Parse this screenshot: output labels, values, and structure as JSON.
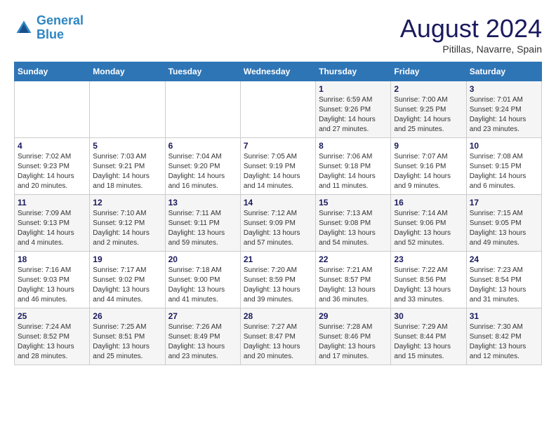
{
  "header": {
    "logo_line1": "General",
    "logo_line2": "Blue",
    "title": "August 2024",
    "subtitle": "Pitillas, Navarre, Spain"
  },
  "days_of_week": [
    "Sunday",
    "Monday",
    "Tuesday",
    "Wednesday",
    "Thursday",
    "Friday",
    "Saturday"
  ],
  "weeks": [
    [
      {
        "day": "",
        "info": ""
      },
      {
        "day": "",
        "info": ""
      },
      {
        "day": "",
        "info": ""
      },
      {
        "day": "",
        "info": ""
      },
      {
        "day": "1",
        "info": "Sunrise: 6:59 AM\nSunset: 9:26 PM\nDaylight: 14 hours and 27 minutes."
      },
      {
        "day": "2",
        "info": "Sunrise: 7:00 AM\nSunset: 9:25 PM\nDaylight: 14 hours and 25 minutes."
      },
      {
        "day": "3",
        "info": "Sunrise: 7:01 AM\nSunset: 9:24 PM\nDaylight: 14 hours and 23 minutes."
      }
    ],
    [
      {
        "day": "4",
        "info": "Sunrise: 7:02 AM\nSunset: 9:23 PM\nDaylight: 14 hours and 20 minutes."
      },
      {
        "day": "5",
        "info": "Sunrise: 7:03 AM\nSunset: 9:21 PM\nDaylight: 14 hours and 18 minutes."
      },
      {
        "day": "6",
        "info": "Sunrise: 7:04 AM\nSunset: 9:20 PM\nDaylight: 14 hours and 16 minutes."
      },
      {
        "day": "7",
        "info": "Sunrise: 7:05 AM\nSunset: 9:19 PM\nDaylight: 14 hours and 14 minutes."
      },
      {
        "day": "8",
        "info": "Sunrise: 7:06 AM\nSunset: 9:18 PM\nDaylight: 14 hours and 11 minutes."
      },
      {
        "day": "9",
        "info": "Sunrise: 7:07 AM\nSunset: 9:16 PM\nDaylight: 14 hours and 9 minutes."
      },
      {
        "day": "10",
        "info": "Sunrise: 7:08 AM\nSunset: 9:15 PM\nDaylight: 14 hours and 6 minutes."
      }
    ],
    [
      {
        "day": "11",
        "info": "Sunrise: 7:09 AM\nSunset: 9:13 PM\nDaylight: 14 hours and 4 minutes."
      },
      {
        "day": "12",
        "info": "Sunrise: 7:10 AM\nSunset: 9:12 PM\nDaylight: 14 hours and 2 minutes."
      },
      {
        "day": "13",
        "info": "Sunrise: 7:11 AM\nSunset: 9:11 PM\nDaylight: 13 hours and 59 minutes."
      },
      {
        "day": "14",
        "info": "Sunrise: 7:12 AM\nSunset: 9:09 PM\nDaylight: 13 hours and 57 minutes."
      },
      {
        "day": "15",
        "info": "Sunrise: 7:13 AM\nSunset: 9:08 PM\nDaylight: 13 hours and 54 minutes."
      },
      {
        "day": "16",
        "info": "Sunrise: 7:14 AM\nSunset: 9:06 PM\nDaylight: 13 hours and 52 minutes."
      },
      {
        "day": "17",
        "info": "Sunrise: 7:15 AM\nSunset: 9:05 PM\nDaylight: 13 hours and 49 minutes."
      }
    ],
    [
      {
        "day": "18",
        "info": "Sunrise: 7:16 AM\nSunset: 9:03 PM\nDaylight: 13 hours and 46 minutes."
      },
      {
        "day": "19",
        "info": "Sunrise: 7:17 AM\nSunset: 9:02 PM\nDaylight: 13 hours and 44 minutes."
      },
      {
        "day": "20",
        "info": "Sunrise: 7:18 AM\nSunset: 9:00 PM\nDaylight: 13 hours and 41 minutes."
      },
      {
        "day": "21",
        "info": "Sunrise: 7:20 AM\nSunset: 8:59 PM\nDaylight: 13 hours and 39 minutes."
      },
      {
        "day": "22",
        "info": "Sunrise: 7:21 AM\nSunset: 8:57 PM\nDaylight: 13 hours and 36 minutes."
      },
      {
        "day": "23",
        "info": "Sunrise: 7:22 AM\nSunset: 8:56 PM\nDaylight: 13 hours and 33 minutes."
      },
      {
        "day": "24",
        "info": "Sunrise: 7:23 AM\nSunset: 8:54 PM\nDaylight: 13 hours and 31 minutes."
      }
    ],
    [
      {
        "day": "25",
        "info": "Sunrise: 7:24 AM\nSunset: 8:52 PM\nDaylight: 13 hours and 28 minutes."
      },
      {
        "day": "26",
        "info": "Sunrise: 7:25 AM\nSunset: 8:51 PM\nDaylight: 13 hours and 25 minutes."
      },
      {
        "day": "27",
        "info": "Sunrise: 7:26 AM\nSunset: 8:49 PM\nDaylight: 13 hours and 23 minutes."
      },
      {
        "day": "28",
        "info": "Sunrise: 7:27 AM\nSunset: 8:47 PM\nDaylight: 13 hours and 20 minutes."
      },
      {
        "day": "29",
        "info": "Sunrise: 7:28 AM\nSunset: 8:46 PM\nDaylight: 13 hours and 17 minutes."
      },
      {
        "day": "30",
        "info": "Sunrise: 7:29 AM\nSunset: 8:44 PM\nDaylight: 13 hours and 15 minutes."
      },
      {
        "day": "31",
        "info": "Sunrise: 7:30 AM\nSunset: 8:42 PM\nDaylight: 13 hours and 12 minutes."
      }
    ]
  ]
}
